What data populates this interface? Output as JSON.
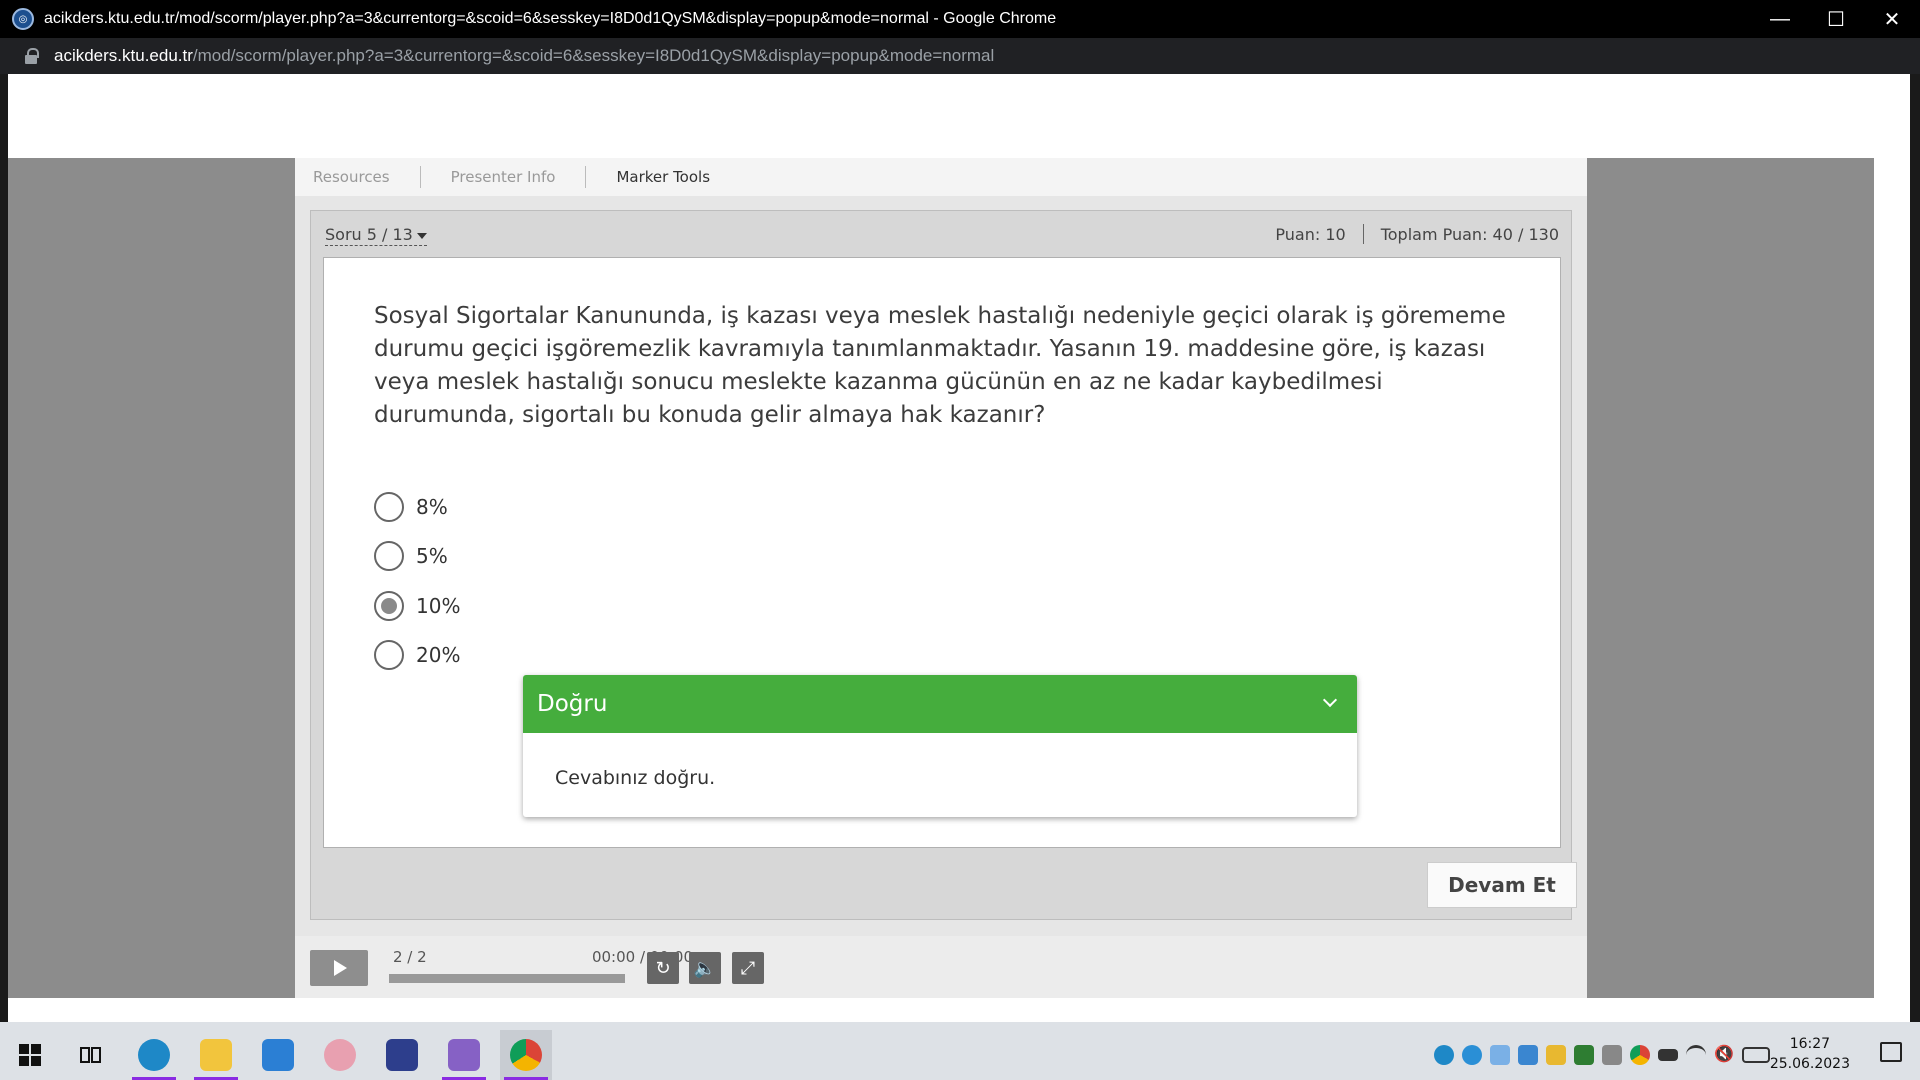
{
  "window": {
    "title": "acikders.ktu.edu.tr/mod/scorm/player.php?a=3&currentorg=&scoid=6&sesskey=I8D0d1QySM&display=popup&mode=normal - Google Chrome",
    "minimize": "—",
    "maximize": "☐",
    "close": "✕"
  },
  "address": {
    "host": "acikders.ktu.edu.tr",
    "path": "/mod/scorm/player.php?a=3&currentorg=&scoid=6&sesskey=I8D0d1QySM&display=popup&mode=normal"
  },
  "tabs": [
    "Resources",
    "Presenter Info",
    "Marker Tools"
  ],
  "quiz": {
    "question_number": "Soru 5 / 13",
    "points": "Puan: 10",
    "total_points": "Toplam Puan: 40 / 130",
    "question": "Sosyal Sigortalar Kanununda, iş kazası veya meslek hastalığı nedeniyle geçici olarak iş görememe durumu geçici işgöremezlik kavramıyla tanımlanmaktadır. Yasanın 19. maddesine göre, iş kazası veya meslek hastalığı sonucu meslekte kazanma gücünün en az ne kadar kaybedilmesi durumunda, sigortalı bu konuda gelir almaya hak kazanır?",
    "options": [
      {
        "label": "8%",
        "selected": false
      },
      {
        "label": "5%",
        "selected": false
      },
      {
        "label": "10%",
        "selected": true
      },
      {
        "label": "20%",
        "selected": false
      }
    ],
    "continue_label": "Devam Et"
  },
  "feedback": {
    "title": "Doğru",
    "message": "Cevabınız doğru.",
    "color": "#45ad3d"
  },
  "controls": {
    "slide_count": "2 / 2",
    "time": "00:00 / 00:00",
    "progress": 0,
    "buttons": [
      "replay-icon",
      "volume-icon",
      "fullscreen-icon"
    ]
  },
  "taskbar": {
    "apps": [
      "edge-icon",
      "python-icon",
      "vscode-icon",
      "paint-icon",
      "devcpp-icon",
      "visual-studio-icon",
      "chrome-icon"
    ],
    "time": "16:27",
    "date": "25.06.2023"
  }
}
